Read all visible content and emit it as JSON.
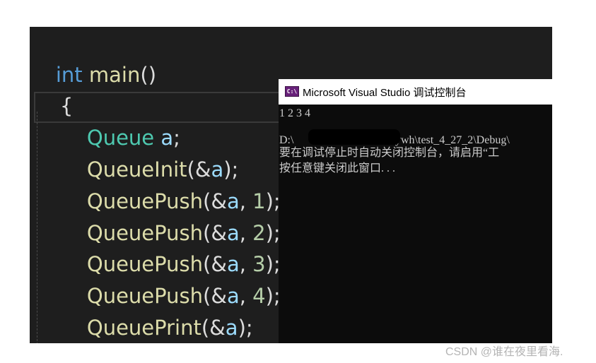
{
  "editor": {
    "lines": [
      {
        "parts": [
          "int",
          " ",
          "main",
          "()"
        ]
      },
      {
        "parts": [
          "{"
        ]
      },
      {
        "parts": [
          "Queue",
          " ",
          "a",
          ";"
        ]
      },
      {
        "parts": [
          "QueueInit",
          "(&",
          "a",
          ");"
        ]
      },
      {
        "parts": [
          "QueuePush",
          "(&",
          "a",
          ", ",
          "1",
          ");"
        ]
      },
      {
        "parts": [
          "QueuePush",
          "(&",
          "a",
          ", ",
          "2",
          ");"
        ]
      },
      {
        "parts": [
          "QueuePush",
          "(&",
          "a",
          ", ",
          "3",
          ");"
        ]
      },
      {
        "parts": [
          "QueuePush",
          "(&",
          "a",
          ", ",
          "4",
          ");"
        ]
      },
      {
        "parts": [
          "QueuePrint",
          "(&",
          "a",
          ");"
        ]
      }
    ]
  },
  "console": {
    "title": "Microsoft Visual Studio 调试控制台",
    "icon_label": "C:\\",
    "icon": "visual-studio-icon",
    "output_line_1": "1 2 3 4",
    "path_prefix": "D:\\",
    "path_suffix": "ywh\\test_4_27_2\\Debug\\",
    "message_line": "要在调试停止时自动关闭控制台，请启用“工",
    "press_key_line": "按任意键关闭此窗口. . ."
  },
  "watermark": "CSDN @谁在夜里看海."
}
